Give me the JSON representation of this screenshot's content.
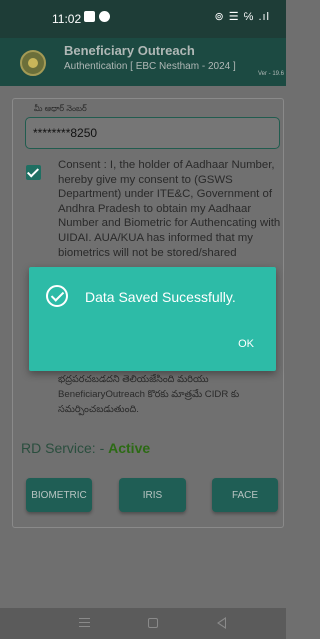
{
  "status_bar": {
    "time": "11:02",
    "signal_icons": "⊚ ☰ ℅ .ıl"
  },
  "header": {
    "title": "Beneficiary Outreach",
    "subtitle": "Authentication [ EBC Nestham - 2024 ]",
    "version": "Ver - 19.6"
  },
  "form": {
    "aadhaar_label": "మీ ఆధార్ నెంబర్",
    "aadhaar_value": "********8250",
    "consent_checked": true,
    "consent_text_en": "Consent : I, the holder of Aadhaar Number, hereby give my consent to (GSWS Department) under ITE&C, Government of Andhra Pradesh to obtain my Aadhaar Number and Biometric for Authencating with UIDAI. AUA/KUA has informed that my biometrics will not be stored/shared",
    "consent_text_te": "ఇస్తున్నాను.AUA/KUA నా బయోమెట్రిక్ వివరాలను భద్రపరచబడదని తెలియజేసింది మరియు BeneficiaryOutreach కొరకు మాత్రమే CIDR కు సమర్పించబడుతుంది.",
    "rd_service_label": "RD Service: -",
    "rd_service_status": "Active"
  },
  "buttons": {
    "biometric": "BIOMETRIC",
    "iris": "IRIS",
    "face": "FACE"
  },
  "dialog": {
    "message": "Data Saved Sucessfully.",
    "ok_label": "OK"
  },
  "colors": {
    "accent": "#2dbba7",
    "header": "#1c4a42",
    "button": "#1f5e55",
    "active": "#2c6a14"
  }
}
